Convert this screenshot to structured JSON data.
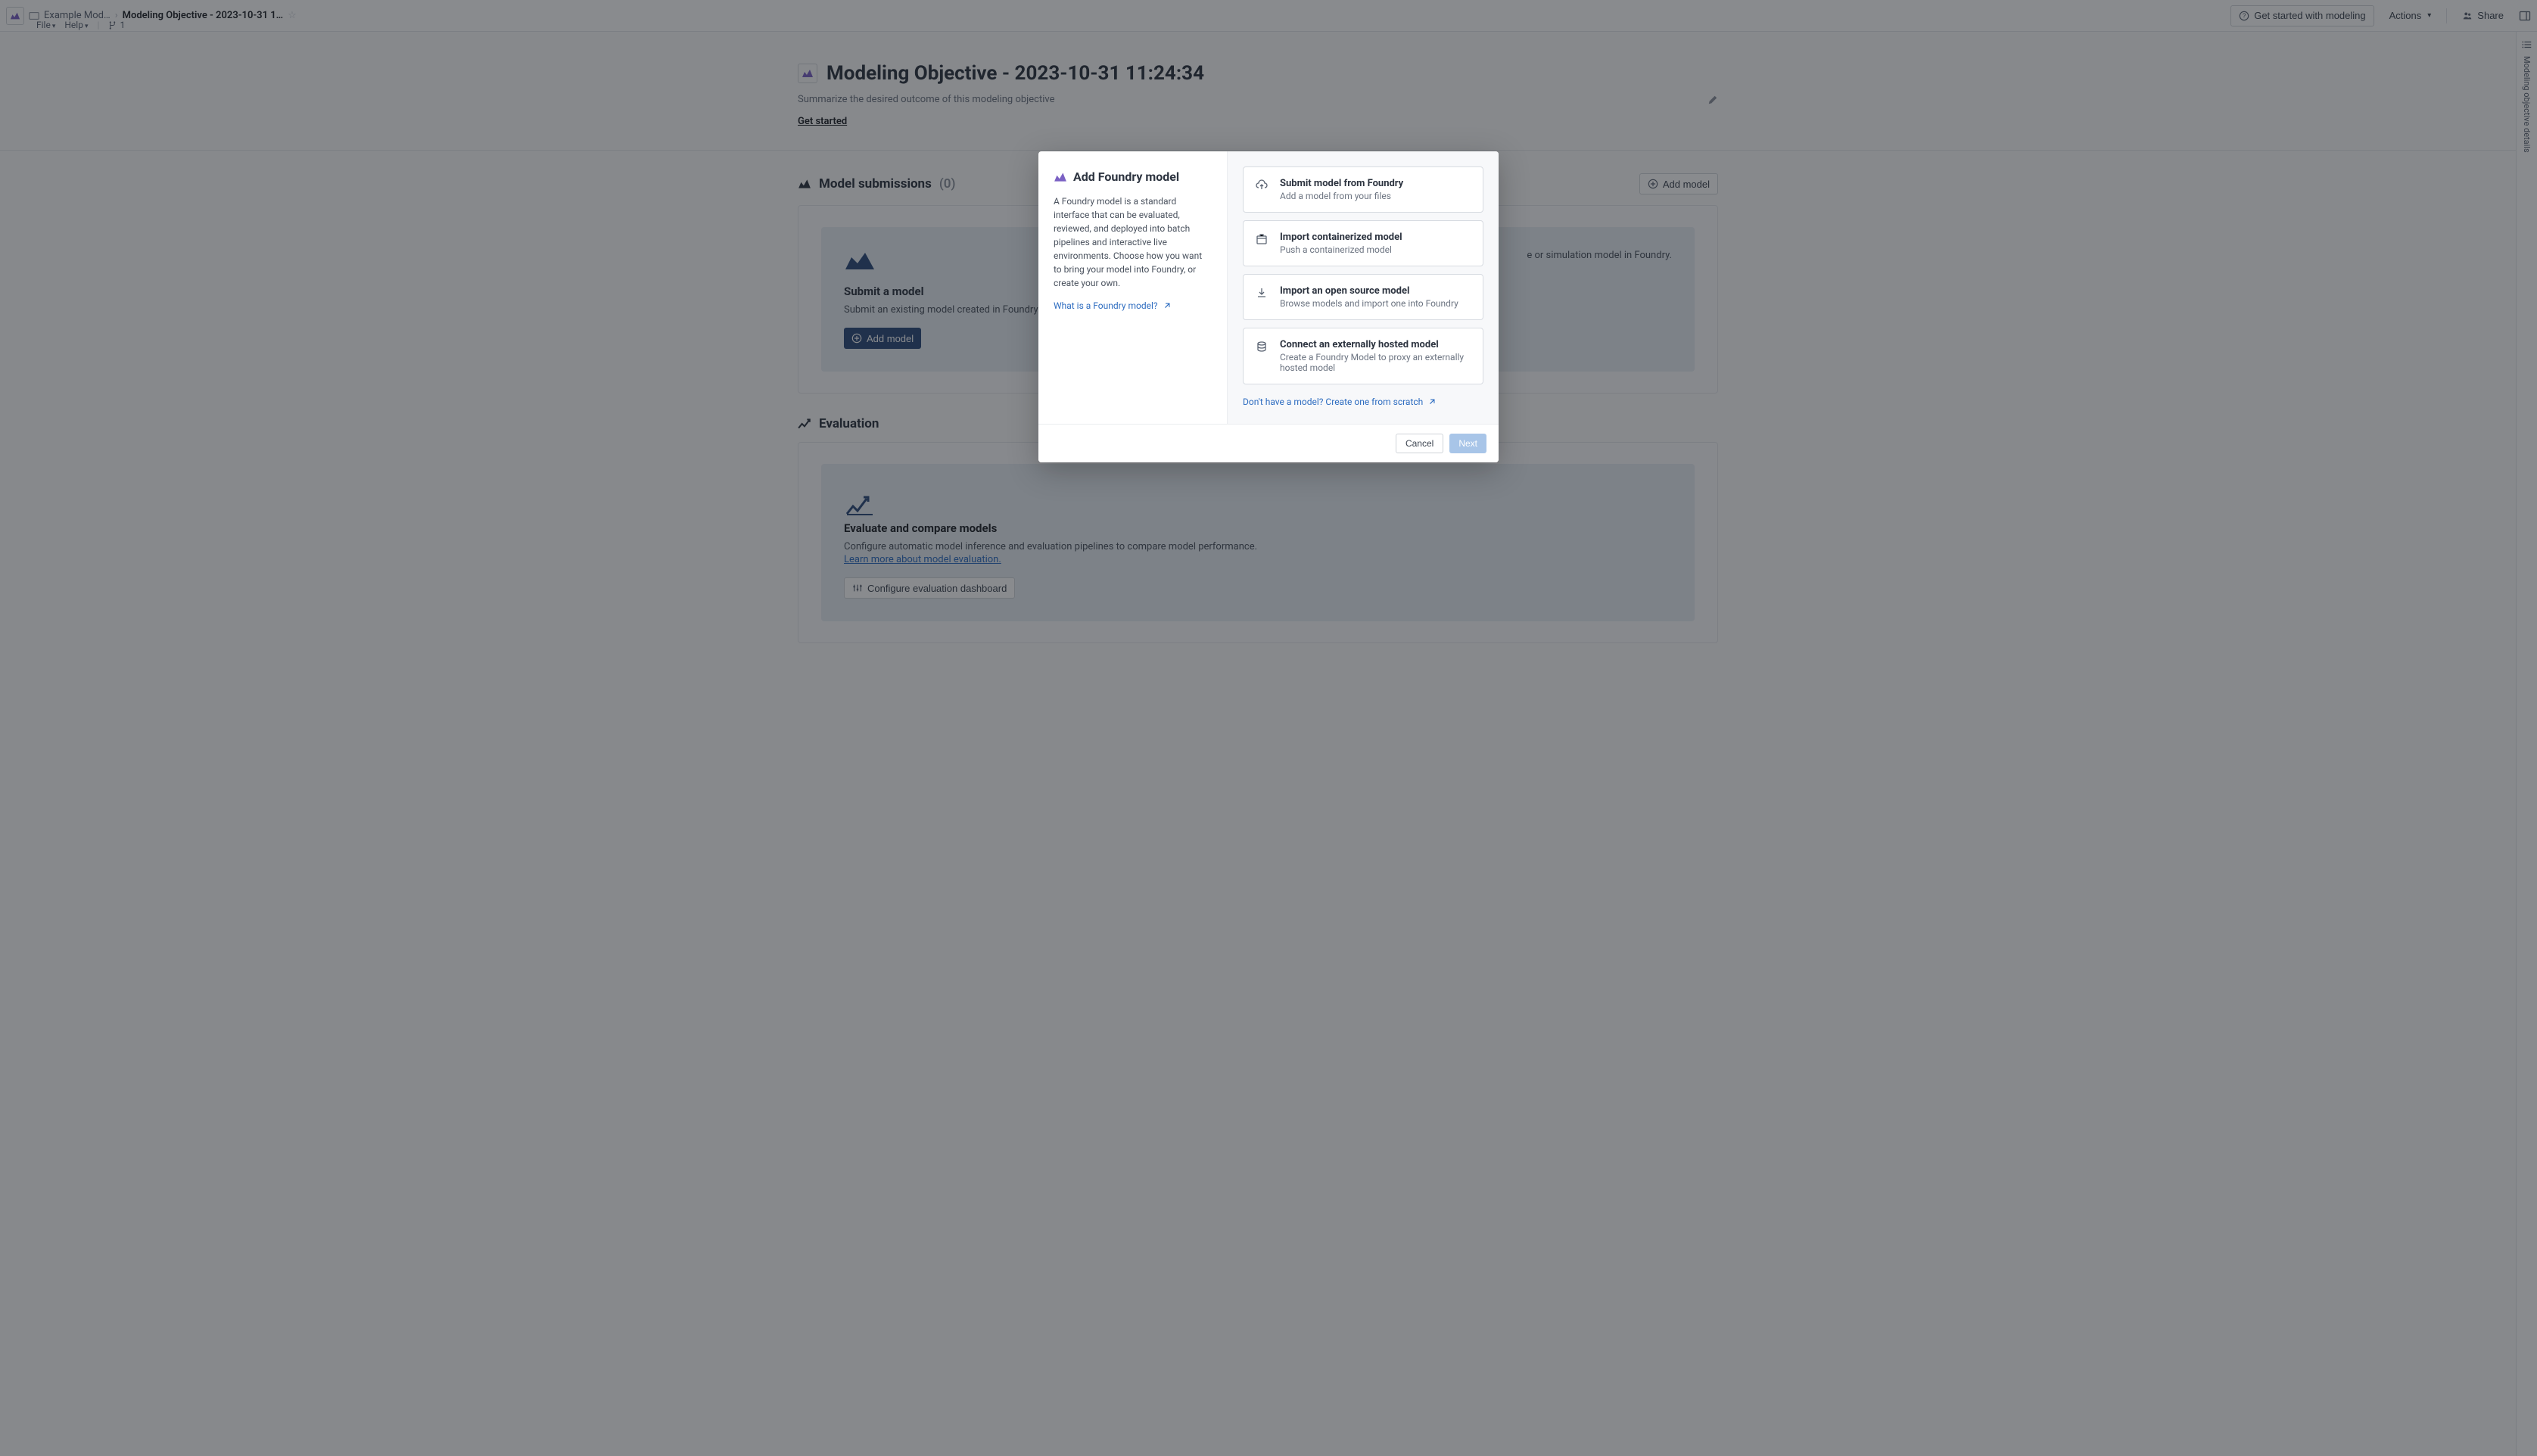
{
  "breadcrumb": {
    "parent": "Example Mod…",
    "current": "Modeling Objective - 2023-10-31 1…"
  },
  "menubar": {
    "file": "File",
    "help": "Help",
    "count": "1"
  },
  "topbar": {
    "get_started": "Get started with modeling",
    "actions": "Actions",
    "share": "Share"
  },
  "page": {
    "title": "Modeling Objective - 2023-10-31 11:24:34",
    "subtitle": "Summarize the desired outcome of this modeling objective",
    "get_started": "Get started"
  },
  "sections": {
    "submissions": {
      "title": "Model submissions",
      "count": "(0)",
      "add_btn": "Add model"
    },
    "evaluation": {
      "title": "Evaluation"
    }
  },
  "cards": {
    "row1": {
      "left": {
        "title": "Submit a model",
        "desc_prefix": "Submit an existing model created in Foundry to your",
        "btn": "Add model"
      },
      "right": {
        "desc_suffix": "e or simulation model in Foundry."
      }
    },
    "eval": {
      "title": "Evaluate and compare models",
      "desc": "Configure automatic model inference and evaluation pipelines to compare model performance.",
      "link": "Learn more about model evaluation.",
      "btn": "Configure evaluation dashboard"
    }
  },
  "rightbar": {
    "label": "Modeling objective details"
  },
  "modal": {
    "title": "Add Foundry model",
    "desc": "A Foundry model is a standard interface that can be evaluated, reviewed, and deployed into batch pipelines and interactive live environments. Choose how you want to bring your model into Foundry, or create your own.",
    "link": "What is a Foundry model?",
    "options": [
      {
        "title": "Submit model from Foundry",
        "sub": "Add a model from your files"
      },
      {
        "title": "Import containerized model",
        "sub": "Push a containerized model"
      },
      {
        "title": "Import an open source model",
        "sub": "Browse models and import one into Foundry"
      },
      {
        "title": "Connect an externally hosted model",
        "sub": "Create a Foundry Model to proxy an externally hosted model"
      }
    ],
    "scratch": "Don't have a model? Create one from scratch",
    "cancel": "Cancel",
    "next": "Next"
  }
}
